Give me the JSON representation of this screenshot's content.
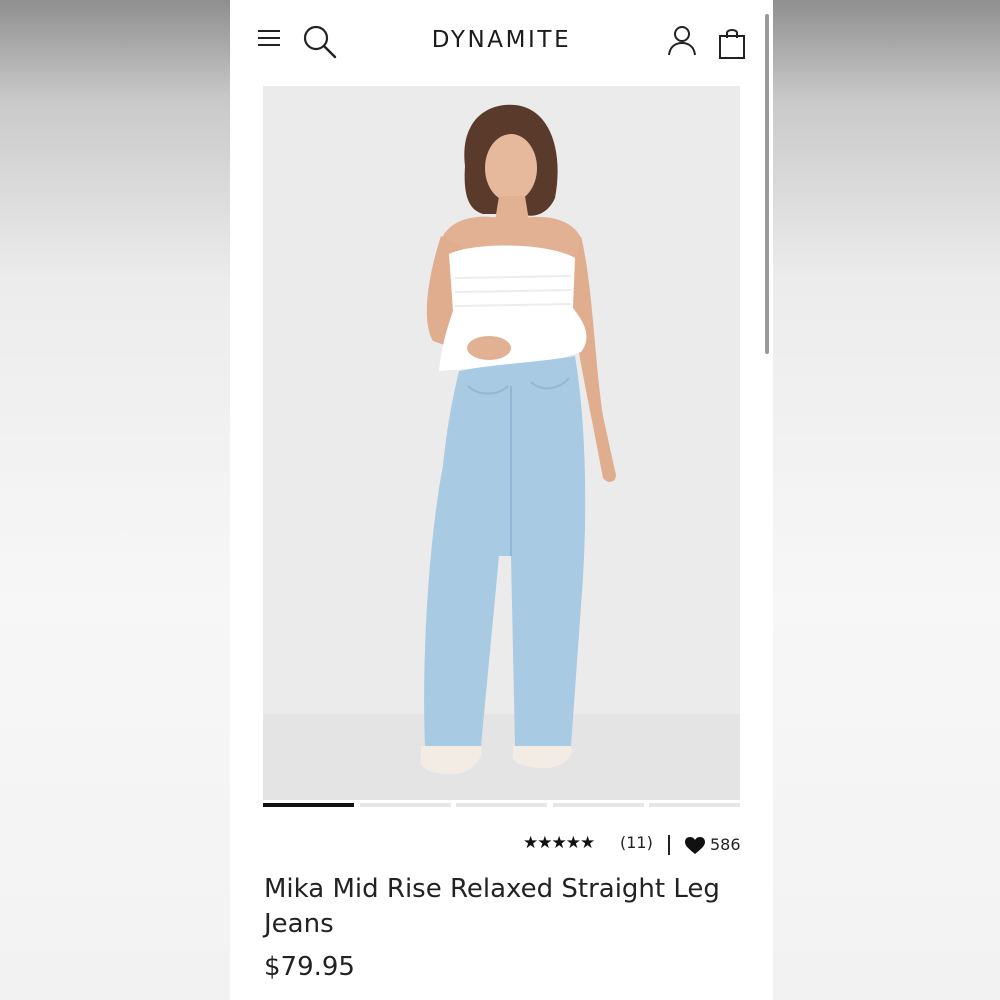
{
  "brand": {
    "logo": "DYNAMITE"
  },
  "header": {
    "menu_icon": "hamburger-menu-icon",
    "search_icon": "search-icon",
    "account_icon": "account-icon",
    "bag_icon": "shopping-bag-icon"
  },
  "product": {
    "title": "Mika Mid Rise Relaxed Straight Leg Jeans",
    "price": "$79.95",
    "rating": {
      "stars": "★★★★★",
      "value": 5,
      "review_count": "(11)"
    },
    "likes": "586",
    "like_icon": "heart-icon",
    "separator": "|"
  },
  "carousel": {
    "total_slides": 5,
    "active_slide": 1
  },
  "colors": {
    "text": "#222222",
    "active_indicator": "#111111",
    "inactive_indicator": "#e6e6e6",
    "background": "#ffffff"
  }
}
